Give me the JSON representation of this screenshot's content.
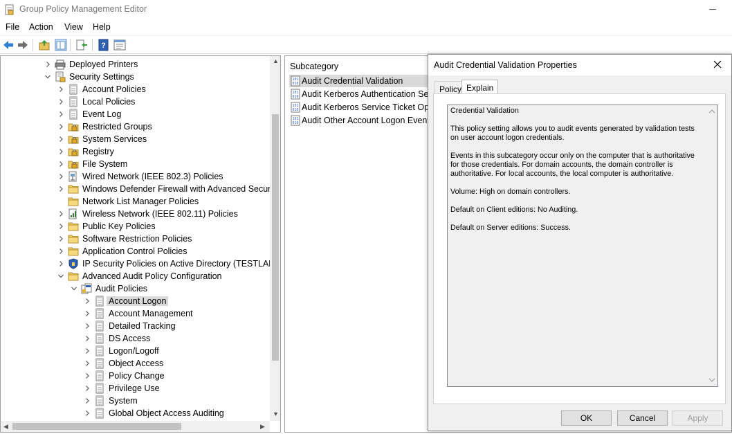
{
  "window": {
    "title": "Group Policy Management Editor"
  },
  "menu": [
    "File",
    "Action",
    "View",
    "Help"
  ],
  "toolbar": {
    "icons": [
      "back-icon",
      "forward-icon",
      "up-folder-icon",
      "show-hide-tree-icon",
      "export-list-icon",
      "help-icon",
      "properties-icon"
    ]
  },
  "tree": [
    {
      "label": "Deployed Printers",
      "indent": 1,
      "chev": "right",
      "icon": "printer"
    },
    {
      "label": "Security Settings",
      "indent": 1,
      "chev": "down",
      "icon": "lock-doc"
    },
    {
      "label": "Account Policies",
      "indent": 2,
      "chev": "right",
      "icon": "doc"
    },
    {
      "label": "Local Policies",
      "indent": 2,
      "chev": "right",
      "icon": "doc"
    },
    {
      "label": "Event Log",
      "indent": 2,
      "chev": "right",
      "icon": "doc"
    },
    {
      "label": "Restricted Groups",
      "indent": 2,
      "chev": "right",
      "icon": "lock-folder"
    },
    {
      "label": "System Services",
      "indent": 2,
      "chev": "right",
      "icon": "lock-folder"
    },
    {
      "label": "Registry",
      "indent": 2,
      "chev": "right",
      "icon": "lock-folder"
    },
    {
      "label": "File System",
      "indent": 2,
      "chev": "right",
      "icon": "lock-folder"
    },
    {
      "label": "Wired Network (IEEE 802.3) Policies",
      "indent": 2,
      "chev": "right",
      "icon": "network"
    },
    {
      "label": "Windows Defender Firewall with Advanced Security",
      "indent": 2,
      "chev": "right",
      "icon": "folder"
    },
    {
      "label": "Network List Manager Policies",
      "indent": 2,
      "chev": "none",
      "icon": "folder"
    },
    {
      "label": "Wireless Network (IEEE 802.11) Policies",
      "indent": 2,
      "chev": "right",
      "icon": "wireless"
    },
    {
      "label": "Public Key Policies",
      "indent": 2,
      "chev": "right",
      "icon": "folder"
    },
    {
      "label": "Software Restriction Policies",
      "indent": 2,
      "chev": "right",
      "icon": "folder"
    },
    {
      "label": "Application Control Policies",
      "indent": 2,
      "chev": "right",
      "icon": "folder"
    },
    {
      "label": "IP Security Policies on Active Directory (TESTLAB.LO",
      "indent": 2,
      "chev": "right",
      "icon": "shield"
    },
    {
      "label": "Advanced Audit Policy Configuration",
      "indent": 2,
      "chev": "down",
      "icon": "folder"
    },
    {
      "label": "Audit Policies",
      "indent": 3,
      "chev": "down",
      "icon": "audit"
    },
    {
      "label": "Account Logon",
      "indent": 4,
      "chev": "right",
      "icon": "doc",
      "selected": true
    },
    {
      "label": "Account Management",
      "indent": 4,
      "chev": "right",
      "icon": "doc"
    },
    {
      "label": "Detailed Tracking",
      "indent": 4,
      "chev": "right",
      "icon": "doc"
    },
    {
      "label": "DS Access",
      "indent": 4,
      "chev": "right",
      "icon": "doc"
    },
    {
      "label": "Logon/Logoff",
      "indent": 4,
      "chev": "right",
      "icon": "doc"
    },
    {
      "label": "Object Access",
      "indent": 4,
      "chev": "right",
      "icon": "doc"
    },
    {
      "label": "Policy Change",
      "indent": 4,
      "chev": "right",
      "icon": "doc"
    },
    {
      "label": "Privilege Use",
      "indent": 4,
      "chev": "right",
      "icon": "doc"
    },
    {
      "label": "System",
      "indent": 4,
      "chev": "right",
      "icon": "doc"
    },
    {
      "label": "Global Object Access Auditing",
      "indent": 4,
      "chev": "right",
      "icon": "doc"
    }
  ],
  "list": {
    "header": "Subcategory",
    "rows": [
      {
        "label": "Audit Credential Validation",
        "selected": true
      },
      {
        "label": "Audit Kerberos Authentication Serv"
      },
      {
        "label": "Audit Kerberos Service Ticket Opera"
      },
      {
        "label": "Audit Other Account Logon Events"
      }
    ]
  },
  "dialog": {
    "title": "Audit Credential Validation Properties",
    "tabs": [
      "Policy",
      "Explain"
    ],
    "active_tab": "Explain",
    "explain_paragraphs": [
      "Credential Validation",
      "This policy setting allows you to audit events generated by validation tests on user account logon credentials.",
      "Events in this subcategory occur only on the computer that is authoritative for those credentials. For domain accounts, the domain controller is authoritative. For local accounts, the local computer is authoritative.",
      "Volume: High on domain controllers.",
      "Default on Client editions: No Auditing.",
      "Default on Server editions: Success."
    ],
    "buttons": {
      "ok": "OK",
      "cancel": "Cancel",
      "apply": "Apply"
    }
  }
}
